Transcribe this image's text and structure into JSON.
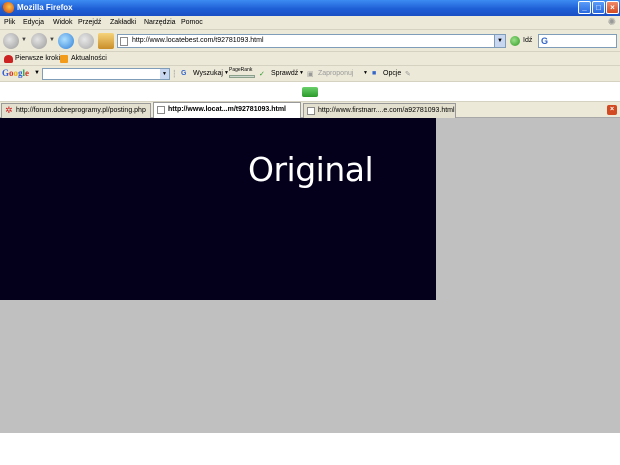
{
  "window": {
    "title": "Mozilla Firefox"
  },
  "menu": [
    "Plik",
    "Edycja",
    "Widok",
    "Przejdź",
    "Zakładki",
    "Narzędzia",
    "Pomoc"
  ],
  "nav": {
    "url": "http://www.locatebest.com/t92781093.html",
    "go_label": "Idź"
  },
  "bookmarks": [
    "Pierwsze kroki",
    "Aktualności"
  ],
  "google_toolbar": {
    "logo": {
      "G": "G",
      "o1": "o",
      "o2": "o",
      "g": "g",
      "l": "l",
      "e": "e"
    },
    "search_label": "Wyszukaj",
    "pagerank_label": "PageRank",
    "check_label": "Sprawdź",
    "recommend_label": "Zaproponuj",
    "options_label": "Opcje"
  },
  "tabs": [
    {
      "label": "http://forum.dobreprogramy.pl/posting.php",
      "active": false
    },
    {
      "label": "http://www.locat...m/t92781093.html",
      "active": true
    },
    {
      "label": "http://www.firstnarr....e.com/a92781093.html",
      "active": false
    }
  ],
  "banner": {
    "text": "Original",
    "bg_color": "#04001b"
  },
  "colors": {
    "page_bg": "#c0c0c0",
    "titlebar": "#1f5fd6"
  }
}
